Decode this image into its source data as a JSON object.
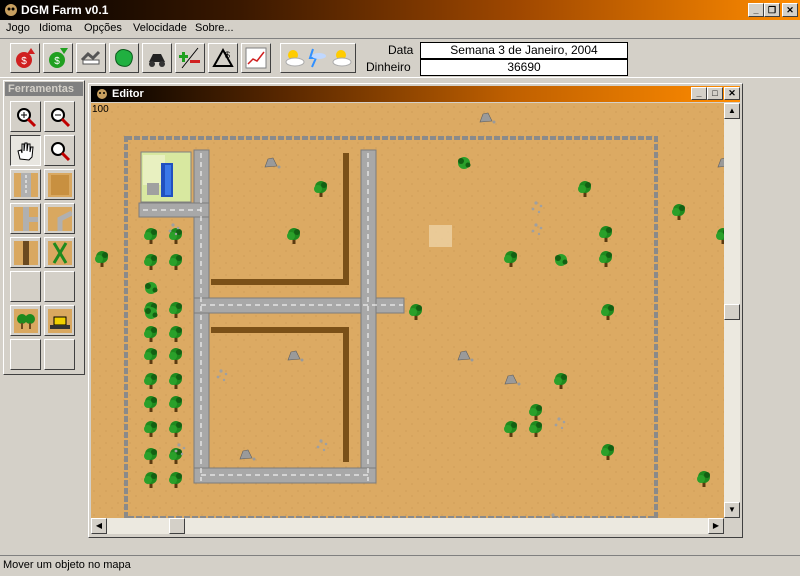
{
  "window": {
    "title": "DGM Farm v0.1"
  },
  "menu": [
    "Jogo",
    "Idioma",
    "Opções",
    "Velocidade",
    "Sobre..."
  ],
  "toolbar": {
    "buttons": [
      "money-out-icon",
      "money-in-icon",
      "handshake-icon",
      "map-icon",
      "tractor-icon",
      "balance-icon",
      "chart-tool-icon",
      "graph-icon",
      "weather-icon"
    ]
  },
  "info": {
    "date_label": "Data",
    "date_value": "Semana 3 de Janeiro, 2004",
    "money_label": "Dinheiro",
    "money_value": "36690"
  },
  "palette": {
    "title": "Ferramentas"
  },
  "editor": {
    "title": "Editor",
    "zoom": "100"
  },
  "status": {
    "text": "Mover um objeto no mapa"
  },
  "colors": {
    "accent": "#ff8c00",
    "sand": "#dcaa63",
    "road": "#a8a8a8",
    "tree": "#1e8a1e"
  }
}
